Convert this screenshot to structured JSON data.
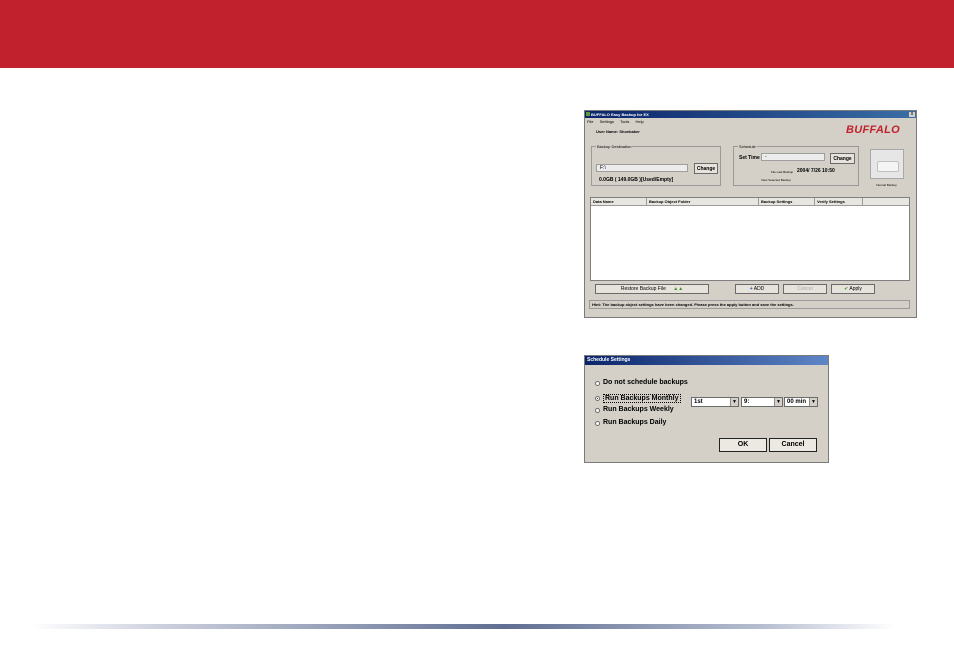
{
  "main_window": {
    "title": "BUFFALO Easy Backup for EX",
    "close": "x",
    "menu": [
      "File",
      "Settings",
      "Tools",
      "Help"
    ],
    "user_name": "User Name: Shoebaker",
    "logo": "BUFFALO",
    "backup_destination": {
      "label": "Backup Destination",
      "path": "F:\\",
      "change_label": "Change",
      "capacity": "0.0GB ( 149.0GB )[Used/Empty]"
    },
    "schedule": {
      "label": "Schedule",
      "set_time_label": "Set Time",
      "set_time_value": "-",
      "change_label": "Change",
      "file_last_backup_label": "File Last Backup",
      "file_last_backup_value": "2004/ 7/26 10:50",
      "view_last_backup": "View Selected Backup"
    },
    "drive_caption": "Internal Backup",
    "table_headers": [
      "Data Name",
      "Backup Object Folder",
      "Backup Settings",
      "Verify Settings"
    ],
    "buttons": {
      "restore": "Restore Backup File",
      "add": "ADD",
      "cancel": "Cancel",
      "apply": "Apply"
    },
    "hint": "Hint: The backup object settings have been changed. Please press the apply button and save the settings."
  },
  "schedule_dialog": {
    "title": "Schedule Settings",
    "options": [
      "Do not schedule backups",
      "Run Backups Monthly",
      "Run Backups Weekly",
      "Run Backups Daily"
    ],
    "selected_index": 1,
    "day_value": "1st",
    "hour_value": "9:",
    "minute_value": "00 min",
    "ok_label": "OK",
    "cancel_label": "Cancel"
  },
  "colors": {
    "banner": "#c1202d",
    "titlebar": "#0a246a"
  }
}
